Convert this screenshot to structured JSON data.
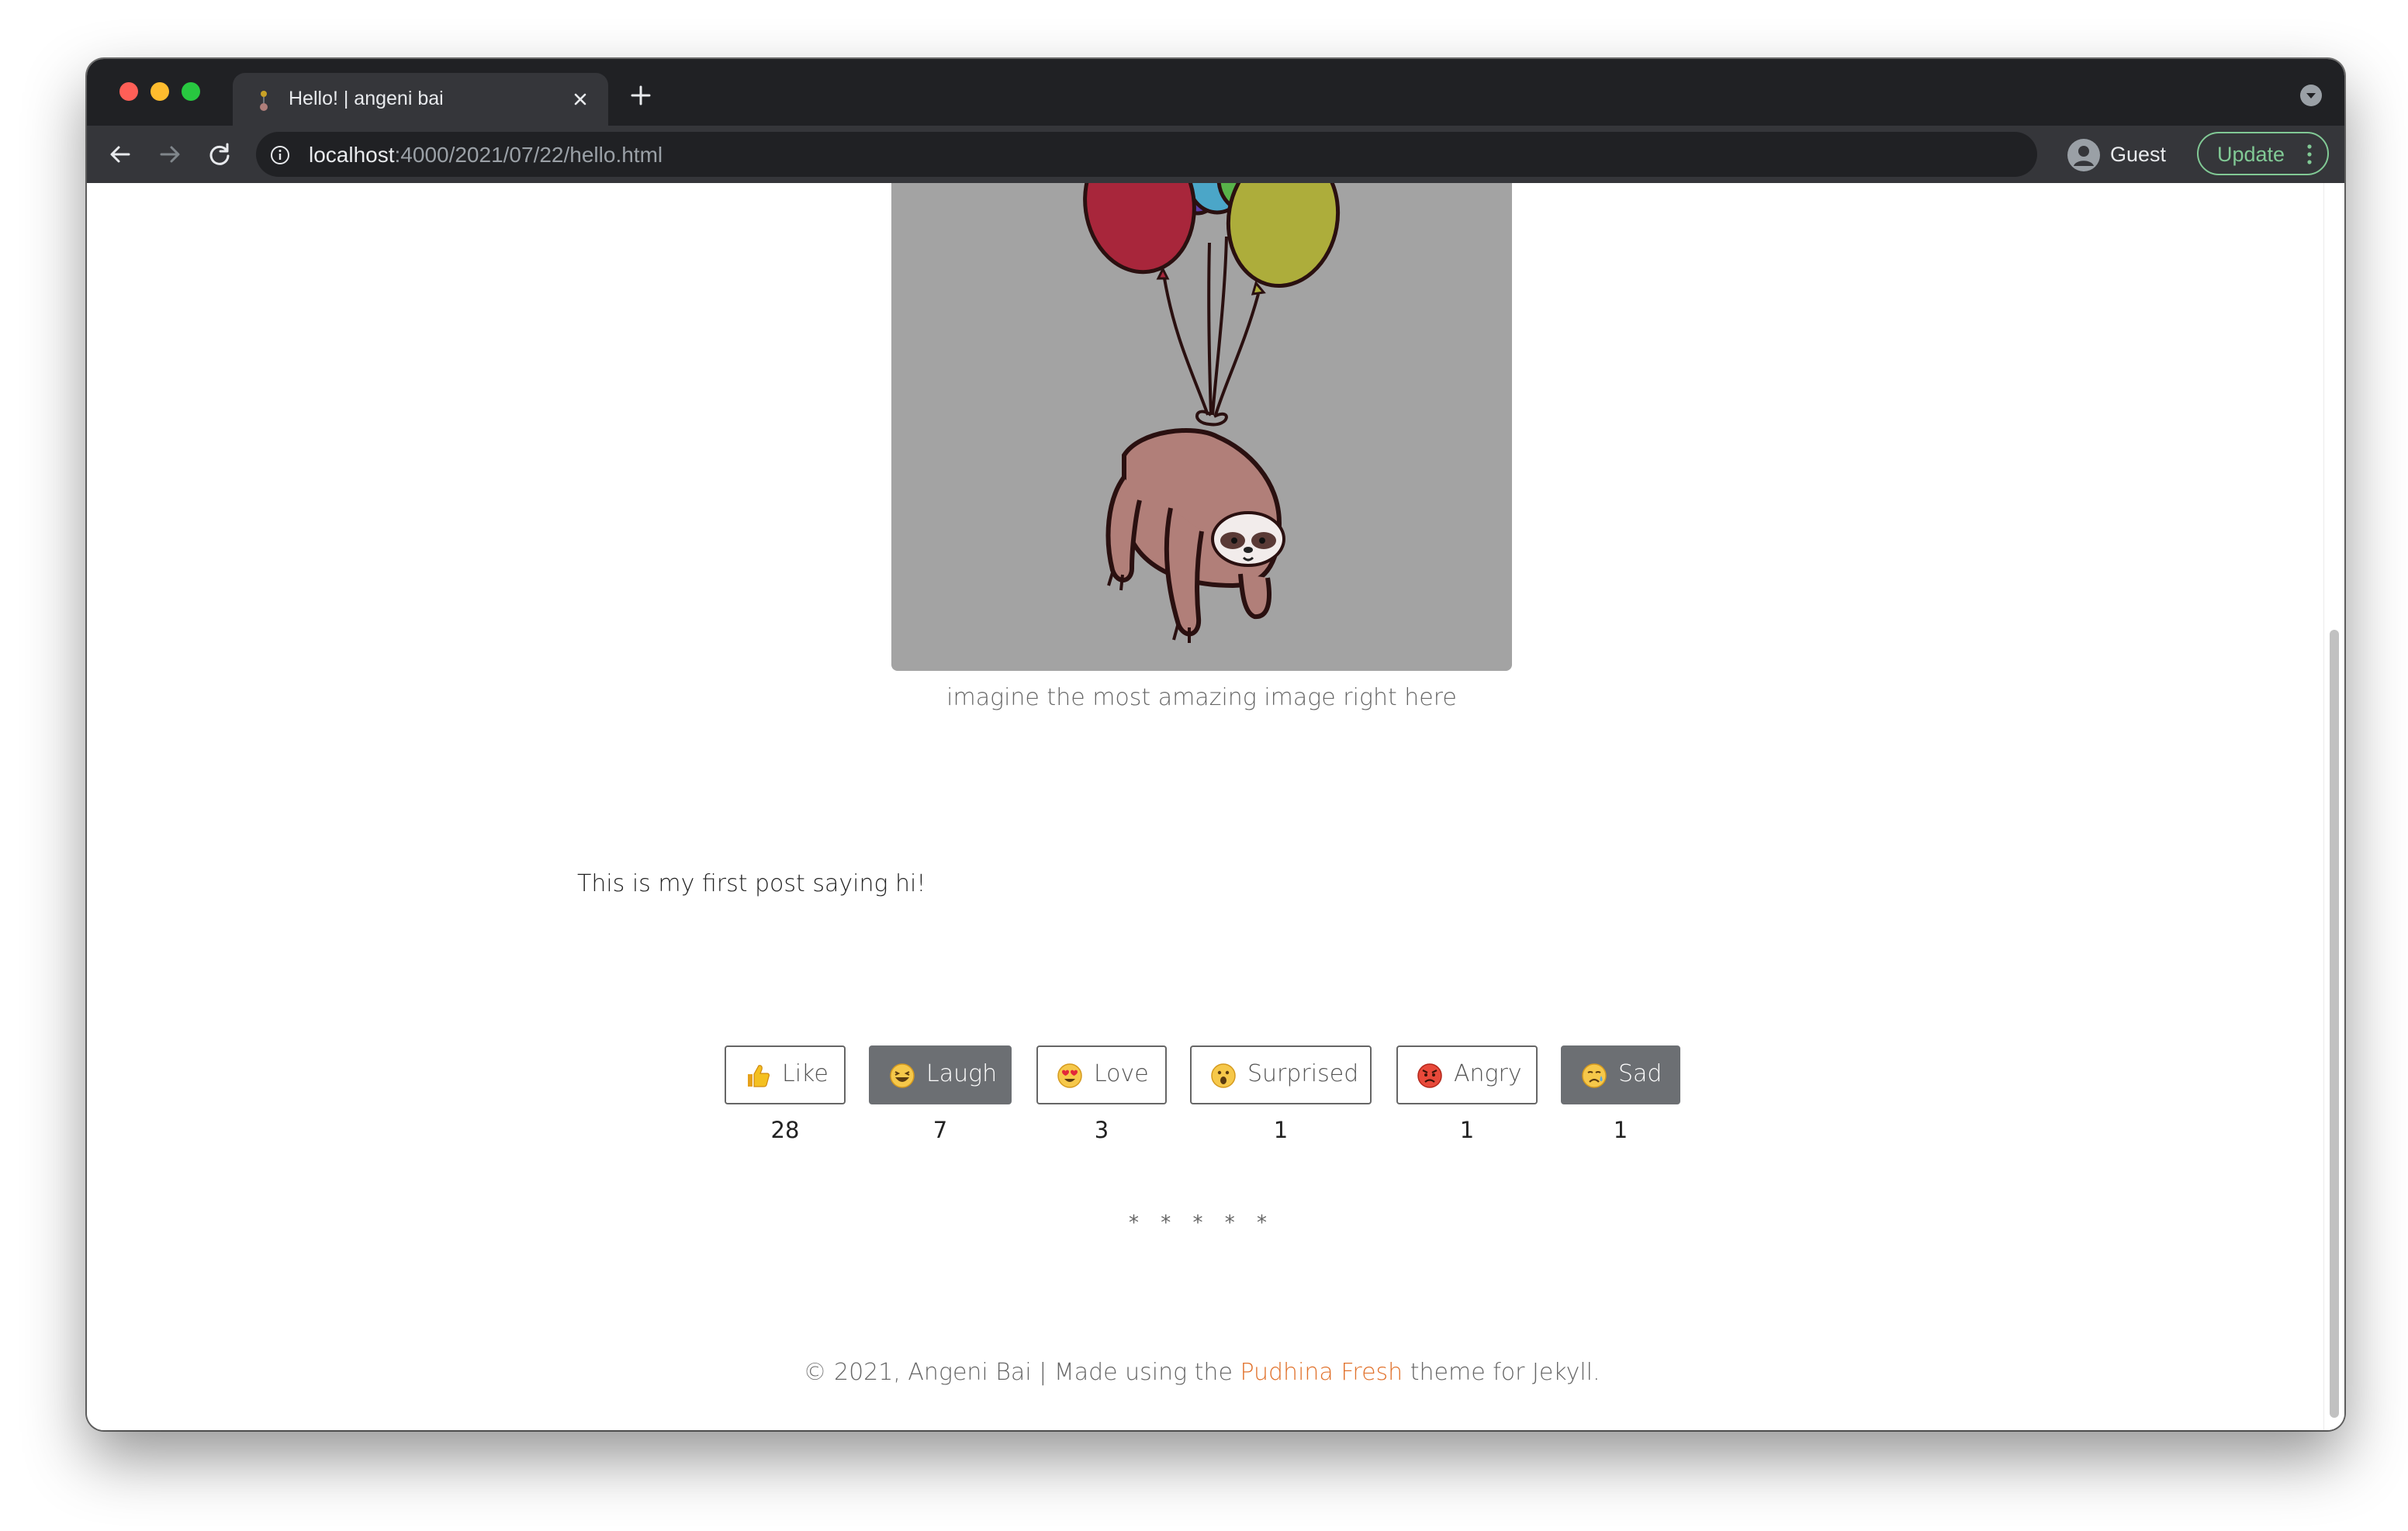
{
  "browser": {
    "tab_title": "Hello! | angeni bai",
    "url_host": "localhost",
    "url_rest": ":4000/2021/07/22/hello.html",
    "profile_name": "Guest",
    "update_label": "Update",
    "favicon": "sloth-favicon"
  },
  "post": {
    "image_subject": "sloth hanging from balloons illustration",
    "caption": "imagine the most amazing image right here",
    "text": "This is my first post saying hi!"
  },
  "reactions": [
    {
      "label": "Like",
      "emoji": "thumbs-up-icon",
      "count": "28",
      "active": false
    },
    {
      "label": "Laugh",
      "emoji": "laugh-face-icon",
      "count": "7",
      "active": true
    },
    {
      "label": "Love",
      "emoji": "heart-eyes-face-icon",
      "count": "3",
      "active": false
    },
    {
      "label": "Surprised",
      "emoji": "surprised-face-icon",
      "count": "1",
      "active": false
    },
    {
      "label": "Angry",
      "emoji": "angry-face-icon",
      "count": "1",
      "active": false
    },
    {
      "label": "Sad",
      "emoji": "sad-face-icon",
      "count": "1",
      "active": true
    }
  ],
  "separator": "* * * * *",
  "footer": {
    "prefix": "© 2021, Angeni Bai | Made using the ",
    "link": "Pudhina Fresh",
    "suffix": " theme for Jekyll."
  },
  "colors": {
    "accent_link": "#e1722c",
    "active_button": "#6c6f73",
    "update_green": "#81c995",
    "browser_frame": "#202124"
  }
}
